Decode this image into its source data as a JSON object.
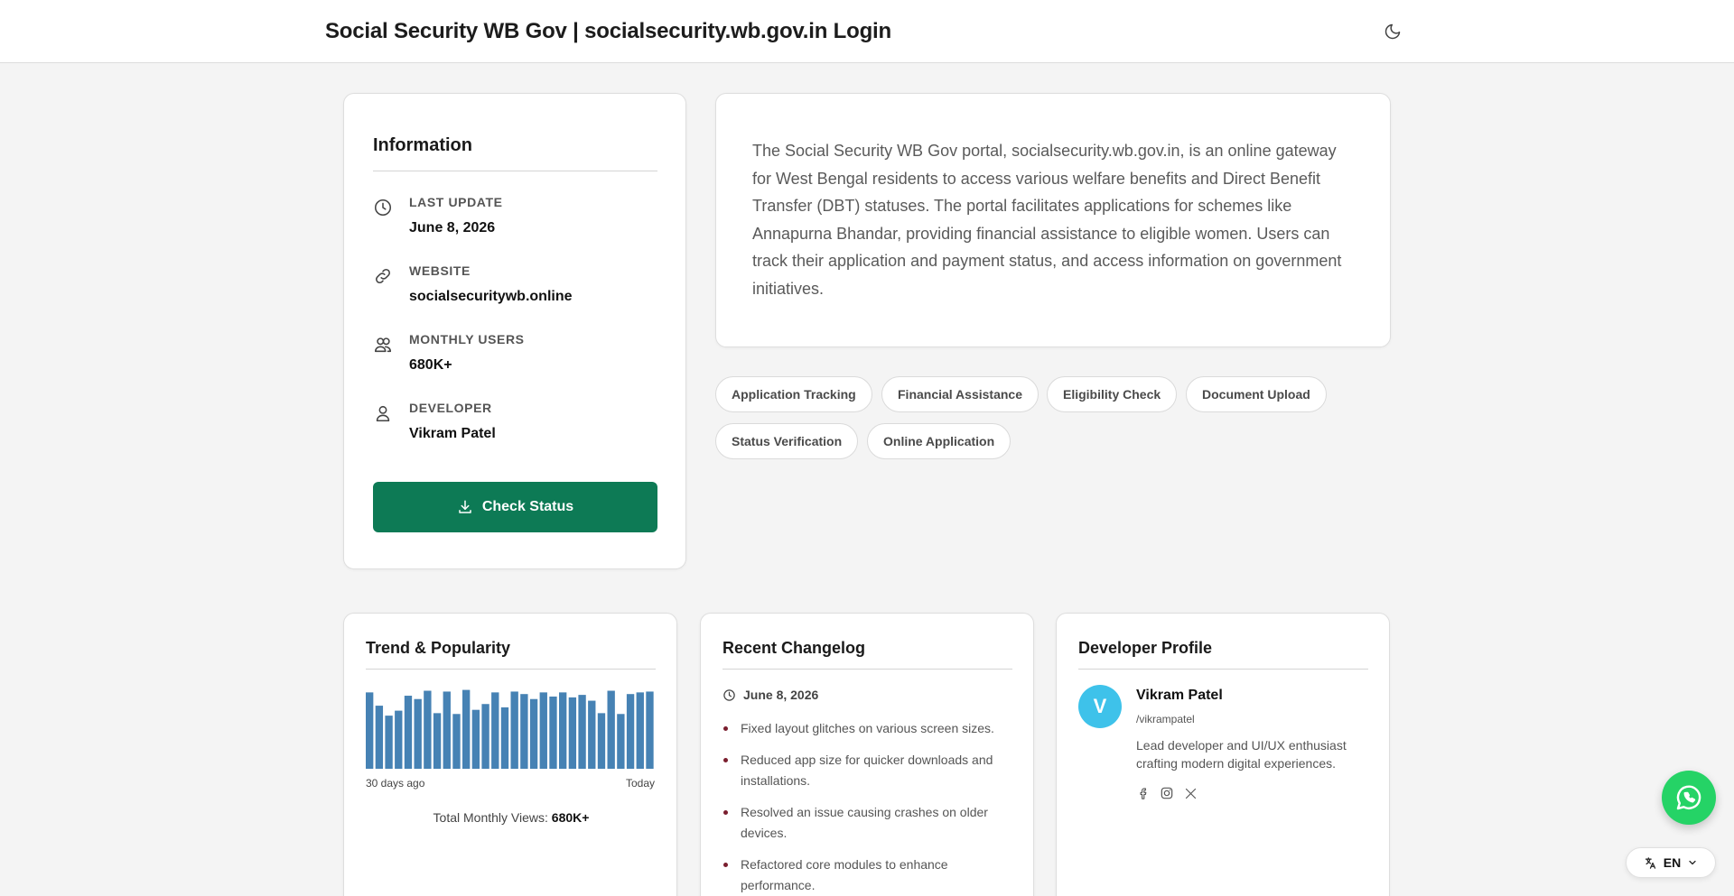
{
  "header": {
    "title": "Social Security WB Gov | socialsecurity.wb.gov.in Login",
    "theme_toggle_icon": "moon-icon"
  },
  "info": {
    "heading": "Information",
    "rows": [
      {
        "icon": "clock-icon",
        "label": "Last Update",
        "value": "June 8, 2026"
      },
      {
        "icon": "link-icon",
        "label": "Website",
        "value": "socialsecuritywb.online"
      },
      {
        "icon": "users-icon",
        "label": "Monthly Users",
        "value": "680K+"
      },
      {
        "icon": "user-icon",
        "label": "Developer",
        "value": "Vikram Patel"
      }
    ],
    "cta_label": "Check Status",
    "cta_icon": "download-icon",
    "cta_color": "#0d7a55"
  },
  "description": "The Social Security WB Gov portal, socialsecurity.wb.gov.in, is an online gateway for West Bengal residents to access various welfare benefits and Direct Benefit Transfer (DBT) statuses. The portal facilitates applications for schemes like Annapurna Bhandar, providing financial assistance to eligible women. Users can track their application and payment status, and access information on government initiatives.",
  "tags": [
    "Application Tracking",
    "Financial Assistance",
    "Eligibility Check",
    "Document Upload",
    "Status Verification",
    "Online Application"
  ],
  "trend": {
    "heading": "Trend & Popularity",
    "left_label": "30 days ago",
    "right_label": "Today",
    "total_label": "Total Monthly Views:",
    "total_value": "680K+",
    "bar_color": "#4682b4"
  },
  "chart_data": {
    "type": "bar",
    "categories": [
      "30 days ago",
      "",
      "",
      "",
      "",
      "",
      "",
      "",
      "",
      "",
      "",
      "",
      "",
      "",
      "",
      "",
      "",
      "",
      "",
      "",
      "",
      "",
      "",
      "",
      "",
      "",
      "",
      "",
      "",
      "Today"
    ],
    "values": [
      92,
      76,
      64,
      70,
      88,
      84,
      94,
      67,
      93,
      66,
      95,
      71,
      78,
      92,
      74,
      93,
      90,
      84,
      92,
      87,
      92,
      86,
      89,
      82,
      67,
      94,
      66,
      90,
      92,
      93
    ],
    "ylim": [
      0,
      100
    ]
  },
  "changelog": {
    "heading": "Recent Changelog",
    "date": "June 8, 2026",
    "items": [
      "Fixed layout glitches on various screen sizes.",
      "Reduced app size for quicker downloads and installations.",
      "Resolved an issue causing crashes on older devices.",
      "Refactored core modules to enhance performance."
    ]
  },
  "developer": {
    "heading": "Developer Profile",
    "initial": "V",
    "avatar_color": "#3ec2ea",
    "name": "Vikram Patel",
    "handle": "/vikrampatel",
    "bio": "Lead developer and UI/UX enthusiast crafting modern digital experiences.",
    "socials": [
      "facebook-icon",
      "instagram-icon",
      "x-icon"
    ]
  },
  "floating": {
    "whatsapp_icon": "whatsapp-icon",
    "whatsapp_color": "#25d366",
    "language": "EN",
    "language_icon": "translate-icon"
  }
}
